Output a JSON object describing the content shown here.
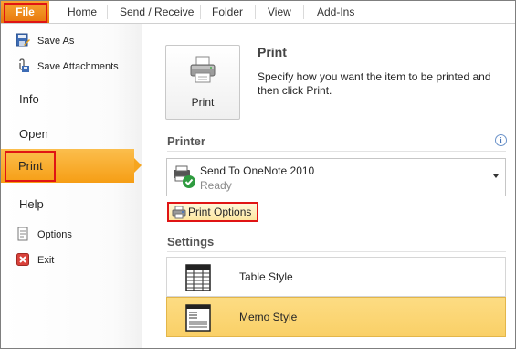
{
  "ribbon": {
    "file_label": "File",
    "tabs": [
      "Home",
      "Send / Receive",
      "Folder",
      "View",
      "Add-Ins"
    ]
  },
  "nav": {
    "save_as": "Save As",
    "save_attachments": "Save Attachments",
    "info": "Info",
    "open": "Open",
    "print": "Print",
    "help": "Help",
    "options": "Options",
    "exit": "Exit"
  },
  "print_panel": {
    "button_label": "Print",
    "heading": "Print",
    "description": "Specify how you want the item to be printed and then click Print."
  },
  "printer": {
    "section_label": "Printer",
    "info_glyph": "i",
    "name": "Send To OneNote 2010",
    "status": "Ready",
    "options_label": "Print Options"
  },
  "settings": {
    "section_label": "Settings",
    "styles": [
      {
        "label": "Table Style",
        "selected": false
      },
      {
        "label": "Memo Style",
        "selected": true
      }
    ]
  },
  "colors": {
    "accent": "#f69e15",
    "highlight_outline": "#e01414",
    "selected_item": "#fad067"
  }
}
